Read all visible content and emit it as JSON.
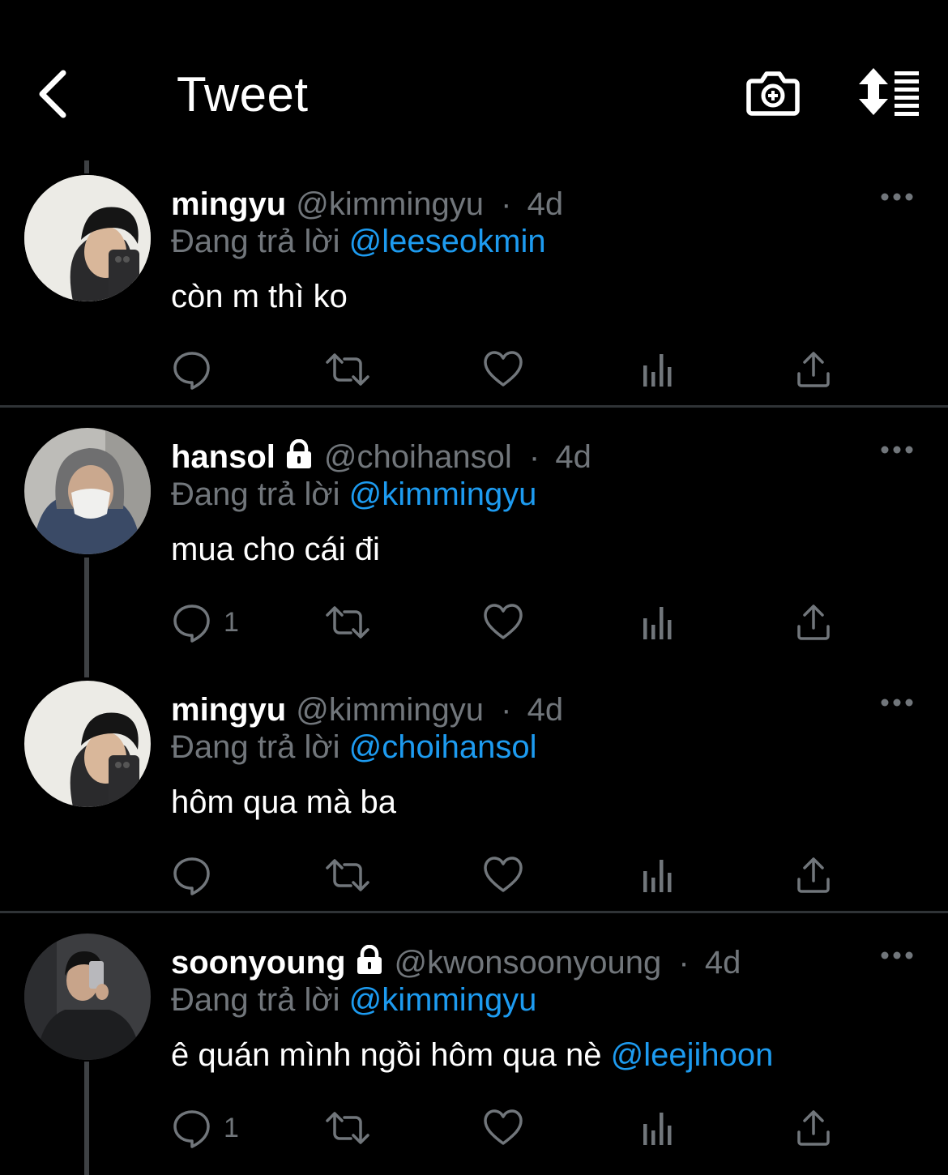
{
  "header": {
    "title": "Tweet",
    "icons": [
      "back-arrow-icon",
      "camera-add-icon",
      "sort-timeline-icon"
    ]
  },
  "colors": {
    "background": "#000000",
    "primary_text": "#ffffff",
    "secondary_text": "#71767b",
    "link": "#1d9bf0",
    "divider": "#2f3336"
  },
  "tweets": [
    {
      "name": "mingyu",
      "handle": "@kimmingyu",
      "separator": "·",
      "time": "4d",
      "locked": false,
      "reply_prefix": "Đang trả lời",
      "reply_to": "@leeseokmin",
      "text": "còn m thì ko",
      "text_mention": "",
      "reply_count": ""
    },
    {
      "name": "hansol",
      "handle": "@choihansol",
      "separator": "·",
      "time": "4d",
      "locked": true,
      "reply_prefix": "Đang trả lời",
      "reply_to": "@kimmingyu",
      "text": "mua cho cái đi",
      "text_mention": "",
      "reply_count": "1"
    },
    {
      "name": "mingyu",
      "handle": "@kimmingyu",
      "separator": "·",
      "time": "4d",
      "locked": false,
      "reply_prefix": "Đang trả lời",
      "reply_to": "@choihansol",
      "text": "hôm qua mà ba",
      "text_mention": "",
      "reply_count": ""
    },
    {
      "name": "soonyoung",
      "handle": "@kwonsoonyoung",
      "separator": "·",
      "time": "4d",
      "locked": true,
      "reply_prefix": "Đang trả lời",
      "reply_to": "@kimmingyu",
      "text": "ê quán mình ngồi hôm qua nè ",
      "text_mention": "@leejihoon",
      "reply_count": "1"
    }
  ]
}
